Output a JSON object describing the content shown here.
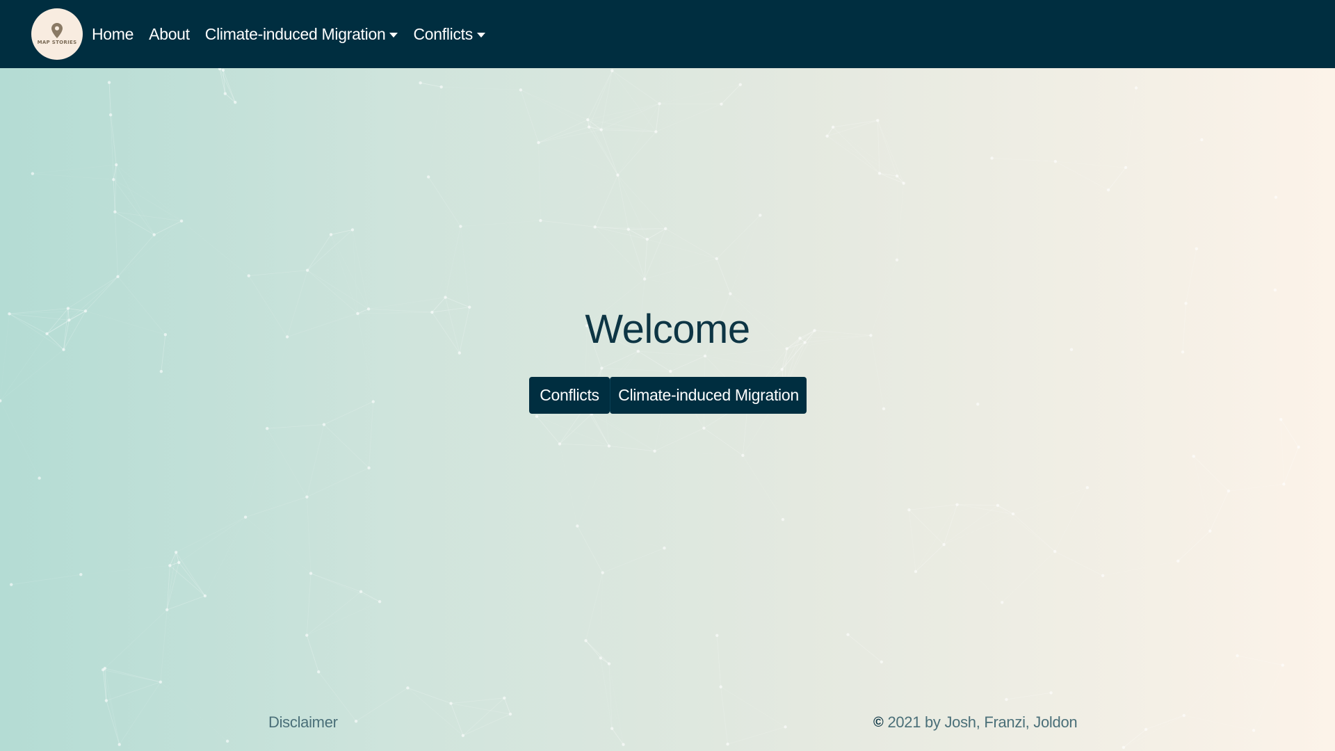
{
  "navbar": {
    "logo_text": "MAP STORIES",
    "items": [
      {
        "label": "Home"
      },
      {
        "label": "About"
      },
      {
        "label": "Climate-induced Migration"
      },
      {
        "label": "Conflicts"
      }
    ]
  },
  "hero": {
    "title": "Welcome",
    "buttons": [
      {
        "label": "Conflicts"
      },
      {
        "label": "Climate-induced Migration"
      }
    ]
  },
  "footer": {
    "disclaimer": "Disclaimer",
    "copyright_symbol": "©",
    "copyright": "2021 by Josh, Franzi, Joldon"
  },
  "colors": {
    "navbar": "#002e40",
    "button": "#002e40",
    "gradient_left": "#b4dcd4",
    "gradient_right": "#fcf3e9"
  },
  "icons": {
    "logo": "map-pin-icon",
    "copyright": "copyright-icon"
  }
}
